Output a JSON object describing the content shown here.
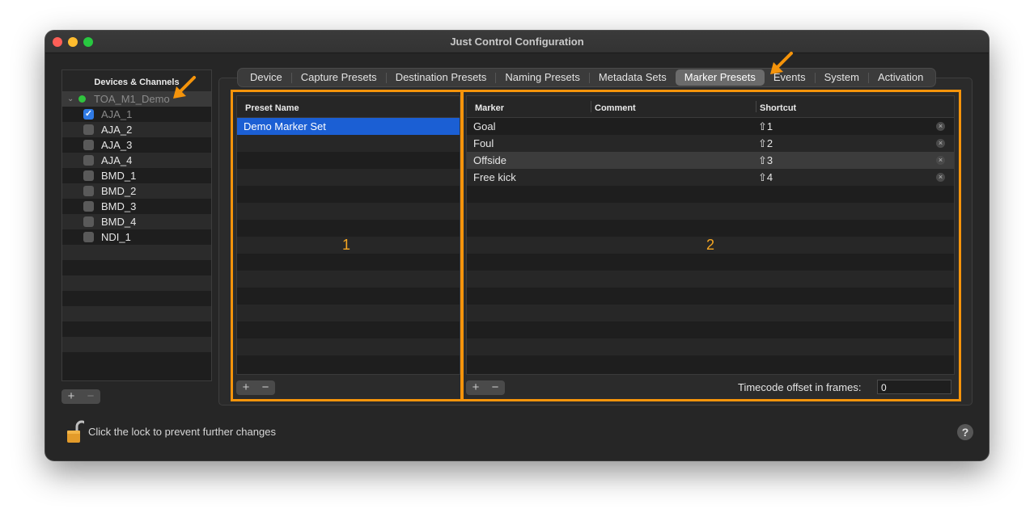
{
  "window": {
    "title": "Just Control Configuration"
  },
  "sidebar": {
    "header": "Devices & Channels",
    "device": {
      "label": "TOA_M1_Demo"
    },
    "channels": [
      {
        "label": "AJA_1",
        "checked": true
      },
      {
        "label": "AJA_2",
        "checked": false
      },
      {
        "label": "AJA_3",
        "checked": false
      },
      {
        "label": "AJA_4",
        "checked": false
      },
      {
        "label": "BMD_1",
        "checked": false
      },
      {
        "label": "BMD_2",
        "checked": false
      },
      {
        "label": "BMD_3",
        "checked": false
      },
      {
        "label": "BMD_4",
        "checked": false
      },
      {
        "label": "NDI_1",
        "checked": false
      }
    ],
    "add_label": "+",
    "remove_label": "−"
  },
  "tabs": [
    "Device",
    "Capture Presets",
    "Destination Presets",
    "Naming Presets",
    "Metadata Sets",
    "Marker Presets",
    "Events",
    "System",
    "Activation"
  ],
  "active_tab": "Marker Presets",
  "presets_table": {
    "header": "Preset Name",
    "rows": [
      "Demo Marker Set"
    ],
    "add_label": "+",
    "remove_label": "−",
    "annotation": "1"
  },
  "markers_table": {
    "headers": {
      "marker": "Marker",
      "comment": "Comment",
      "shortcut": "Shortcut"
    },
    "rows": [
      {
        "marker": "Goal",
        "comment": "",
        "shortcut": "⇧1"
      },
      {
        "marker": "Foul",
        "comment": "",
        "shortcut": "⇧2"
      },
      {
        "marker": "Offside",
        "comment": "",
        "shortcut": "⇧3"
      },
      {
        "marker": "Free kick",
        "comment": "",
        "shortcut": "⇧4"
      }
    ],
    "clear_label": "×",
    "add_label": "+",
    "remove_label": "−",
    "annotation": "2",
    "timecode_label": "Timecode offset in frames:",
    "timecode_value": "0"
  },
  "footer": {
    "lock_text": "Click the lock to prevent further changes",
    "help_label": "?"
  },
  "colors": {
    "accent": "#f5940b",
    "selection": "#1b5fd4",
    "status_green": "#30c43e"
  }
}
